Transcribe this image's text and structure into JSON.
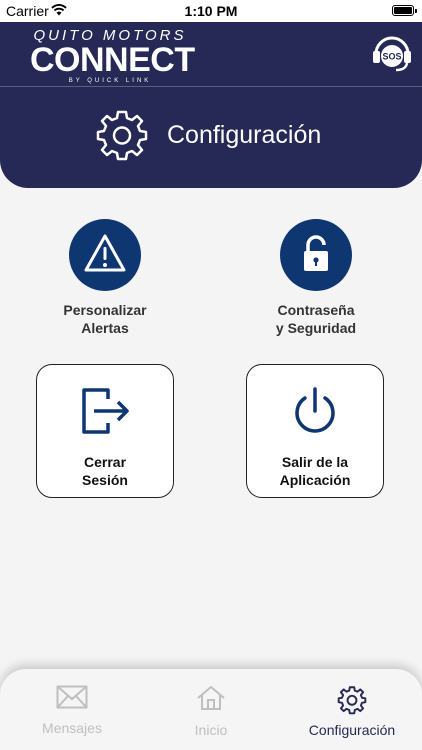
{
  "status_bar": {
    "carrier": "Carrier",
    "time": "1:10 PM"
  },
  "header": {
    "logo_top": "QUITO MOTORS",
    "logo_main": "CONNECT",
    "logo_sub": "BY QUICK LINK",
    "sos_label": "SOS",
    "title": "Configuración"
  },
  "options": {
    "alerts_label_line1": "Personalizar",
    "alerts_label_line2": "Alertas",
    "security_label_line1": "Contraseña",
    "security_label_line2": "y Seguridad",
    "logout_label_line1": "Cerrar",
    "logout_label_line2": "Sesión",
    "exit_label_line1": "Salir de la",
    "exit_label_line2": "Aplicación"
  },
  "tab_bar": {
    "messages": "Mensajes",
    "home": "Inicio",
    "settings": "Configuración",
    "active": "settings"
  },
  "colors": {
    "header_bg": "#262955",
    "icon_circle": "#0e3771",
    "active_tab": "#262955",
    "inactive_tab": "#bfbfbf"
  }
}
